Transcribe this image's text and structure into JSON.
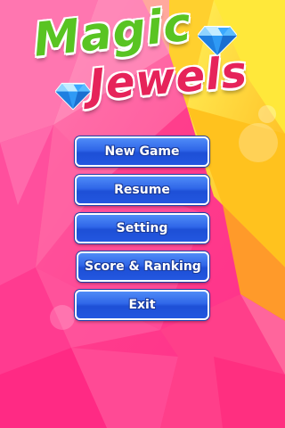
{
  "logo": {
    "line1": "Magic",
    "line2": "Jewels",
    "line1_color": "#59c422",
    "line2_color": "#e6235a",
    "gem_icon": "diamond-icon"
  },
  "menu": {
    "items": [
      {
        "label": "New Game"
      },
      {
        "label": "Resume"
      },
      {
        "label": "Setting"
      },
      {
        "label": "Score & Ranking"
      },
      {
        "label": "Exit"
      }
    ]
  },
  "colors": {
    "button_blue": "#2f66e8",
    "background_pink": "#ff3e9a",
    "background_yellow": "#ffe81c"
  }
}
